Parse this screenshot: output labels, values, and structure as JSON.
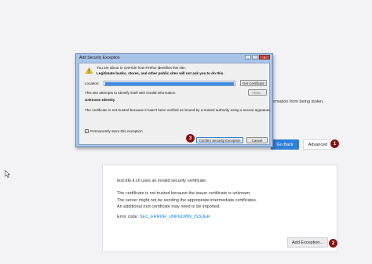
{
  "background_page": {
    "text_snippet": "ormation from being stolen,",
    "go_back_label": "Go Back",
    "advanced_label": "Advanced"
  },
  "advanced_panel": {
    "line1": "test.dfe.ti.ch uses an invalid security certificate.",
    "line2": "The certificate is not trusted because the issuer certificate is unknown.",
    "line3": "The server might not be sending the appropriate intermediate certificates.",
    "line4": "An additional root certificate may need to be imported.",
    "error_code_prefix": "Error code:",
    "error_code": "SEC_ERROR_UNKNOWN_ISSUER",
    "add_exception_label": "Add Exception..."
  },
  "badges": {
    "advanced": "1",
    "add_exception": "2",
    "confirm": "3"
  },
  "dialog": {
    "title": "Add Security Exception",
    "intro": "You are about to override how Firefox identifies this site.",
    "warning": "Legitimate banks, stores, and other public sites will not ask you to do this.",
    "location_label": "Location:",
    "get_certificate_label": "Get Certificate",
    "identify_text": "This site attempts to identify itself with invalid information.",
    "view_label": "View...",
    "unknown_identity_heading": "Unknown Identity",
    "unknown_identity_desc": "The certificate is not trusted because it hasn't been verified as issued by a trusted authority using a secure signature.",
    "permanent_label": "Permanently store this exception",
    "permanent_checked": "✓",
    "confirm_label": "Confirm Security Exception",
    "cancel_label": "Cancel"
  },
  "colors": {
    "accent": "#2f7fd8",
    "badge": "#8a1212",
    "selection": "#3c8de6"
  }
}
